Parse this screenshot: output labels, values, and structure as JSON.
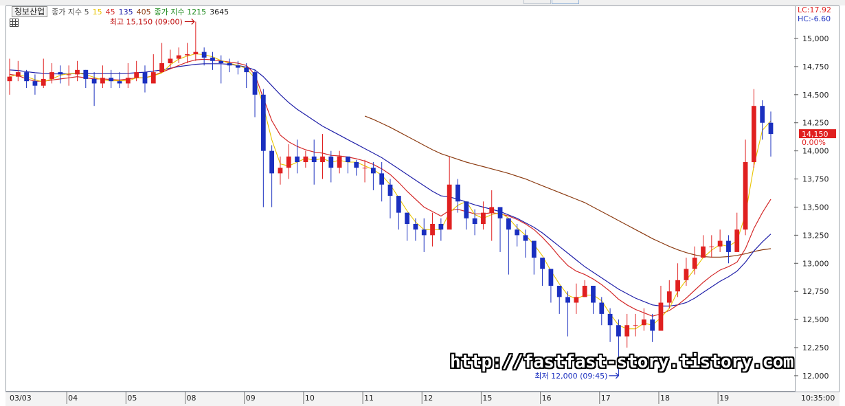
{
  "legend": {
    "stock_name": "청보산업",
    "ma_label": "종가 지수 5",
    "ma_periods": [
      "15",
      "45",
      "135",
      "405"
    ],
    "ma2_label": "종가 지수 1215",
    "ma2_period": "3645"
  },
  "right_header": {
    "lc": "LC:17.92",
    "hc": "HC:-6.60"
  },
  "watermark": "http://fastfast-story.tistory.com",
  "footer_time": "10:35:00",
  "colors": {
    "up": "#e02020",
    "down": "#1a2fbf",
    "ma5": "#e8c400",
    "ma15": "#d42a2a",
    "ma45": "#1f1fa8",
    "ma135": "#8b3a10",
    "ma1215": "#1d8a1d",
    "ma3645": "#222222",
    "grid": "#d8d8d8"
  },
  "chart_data": {
    "type": "candlestick",
    "ylim": [
      11920,
      15220
    ],
    "y_ticks": [
      12000,
      12250,
      12500,
      12750,
      13000,
      13250,
      13500,
      13750,
      14000,
      14250,
      14500,
      14750,
      15000
    ],
    "y_tick_labels": [
      "12,000",
      "12,250",
      "12,500",
      "12,750",
      "13,000",
      "13,250",
      "13,500",
      "13,750",
      "14,000",
      "14,250",
      "14,500",
      "14,750",
      "15,000"
    ],
    "x_day_labels": [
      "03/03",
      "04",
      "05",
      "08",
      "09",
      "10",
      "11",
      "12",
      "15",
      "16",
      "17",
      "18",
      "19"
    ],
    "current_price": 14150,
    "current_price_label": "14,150",
    "change_label": "0.00%",
    "high": {
      "value": 15150,
      "label": "최고 15,150 (09:00)"
    },
    "low": {
      "value": 12000,
      "label": "최저 12,000 (09:45)"
    },
    "closes": [
      14660,
      14700,
      14620,
      14580,
      14640,
      14700,
      14680,
      14680,
      14720,
      14640,
      14600,
      14650,
      14620,
      14600,
      14650,
      14700,
      14600,
      14700,
      14780,
      14820,
      14850,
      14860,
      14880,
      14830,
      14800,
      14780,
      14760,
      14740,
      14700,
      14500,
      14000,
      13800,
      13850,
      13950,
      13900,
      13950,
      13900,
      13950,
      13850,
      13950,
      13900,
      13850,
      13850,
      13800,
      13700,
      13600,
      13450,
      13350,
      13300,
      13250,
      13350,
      13300,
      13700,
      13550,
      13400,
      13350,
      13450,
      13500,
      13400,
      13300,
      13250,
      13200,
      13050,
      12950,
      12800,
      12700,
      12650,
      12700,
      12800,
      12650,
      12550,
      12450,
      12350,
      12450,
      12450,
      12500,
      12400,
      12650,
      12750,
      12850,
      12950,
      13050,
      13150,
      13150,
      13200,
      13100,
      13300,
      13900,
      14400,
      14250,
      14150
    ],
    "ranges": [
      [
        14500,
        14820
      ],
      [
        14620,
        14800
      ],
      [
        14560,
        14720
      ],
      [
        14500,
        14680
      ],
      [
        14560,
        14820
      ],
      [
        14600,
        14780
      ],
      [
        14600,
        14760
      ],
      [
        14580,
        14760
      ],
      [
        14620,
        14800
      ],
      [
        14560,
        14720
      ],
      [
        14400,
        14700
      ],
      [
        14560,
        14760
      ],
      [
        14560,
        14720
      ],
      [
        14560,
        14700
      ],
      [
        14560,
        14780
      ],
      [
        14620,
        14800
      ],
      [
        14520,
        14760
      ],
      [
        14620,
        14860
      ],
      [
        14700,
        14960
      ],
      [
        14740,
        14900
      ],
      [
        14780,
        14920
      ],
      [
        14780,
        14960
      ],
      [
        14800,
        15150
      ],
      [
        14760,
        14920
      ],
      [
        14720,
        14880
      ],
      [
        14600,
        14850
      ],
      [
        14700,
        14820
      ],
      [
        14680,
        14800
      ],
      [
        14560,
        14780
      ],
      [
        14300,
        14720
      ],
      [
        13500,
        14550
      ],
      [
        13500,
        14050
      ],
      [
        13700,
        13950
      ],
      [
        13750,
        14060
      ],
      [
        13800,
        14100
      ],
      [
        13850,
        14000
      ],
      [
        13700,
        14100
      ],
      [
        13750,
        14150
      ],
      [
        13720,
        14000
      ],
      [
        13800,
        14000
      ],
      [
        13800,
        13950
      ],
      [
        13780,
        13920
      ],
      [
        13720,
        13920
      ],
      [
        13650,
        13900
      ],
      [
        13550,
        13900
      ],
      [
        13400,
        13750
      ],
      [
        13300,
        13600
      ],
      [
        13200,
        13450
      ],
      [
        13200,
        13400
      ],
      [
        13100,
        13400
      ],
      [
        13150,
        13450
      ],
      [
        13200,
        13400
      ],
      [
        13500,
        13950
      ],
      [
        13450,
        13750
      ],
      [
        13300,
        13550
      ],
      [
        13250,
        13480
      ],
      [
        13300,
        13550
      ],
      [
        13200,
        13650
      ],
      [
        13100,
        13500
      ],
      [
        12900,
        13400
      ],
      [
        13150,
        13350
      ],
      [
        13050,
        13300
      ],
      [
        12900,
        13150
      ],
      [
        12800,
        13050
      ],
      [
        12650,
        12950
      ],
      [
        12550,
        12800
      ],
      [
        12350,
        12750
      ],
      [
        12550,
        12820
      ],
      [
        12700,
        12850
      ],
      [
        12550,
        12750
      ],
      [
        12450,
        12700
      ],
      [
        12300,
        12600
      ],
      [
        12000,
        12500
      ],
      [
        12250,
        12550
      ],
      [
        12350,
        12550
      ],
      [
        12400,
        12600
      ],
      [
        12300,
        12550
      ],
      [
        12450,
        12800
      ],
      [
        12600,
        12850
      ],
      [
        12700,
        13000
      ],
      [
        12800,
        13050
      ],
      [
        12900,
        13150
      ],
      [
        13050,
        13250
      ],
      [
        13050,
        13250
      ],
      [
        13100,
        13300
      ],
      [
        13000,
        13250
      ],
      [
        13150,
        13450
      ],
      [
        13250,
        14100
      ],
      [
        13850,
        14550
      ],
      [
        14100,
        14450
      ],
      [
        13950,
        14350
      ]
    ],
    "ma15_values": [
      14680,
      14670,
      14640,
      14620,
      14620,
      14630,
      14640,
      14650,
      14660,
      14650,
      14640,
      14640,
      14635,
      14630,
      14640,
      14650,
      14650,
      14670,
      14700,
      14730,
      14760,
      14790,
      14810,
      14815,
      14810,
      14800,
      14790,
      14780,
      14760,
      14680,
      14470,
      14270,
      14140,
      14080,
      14040,
      14010,
      13990,
      13980,
      13960,
      13955,
      13945,
      13930,
      13910,
      13880,
      13840,
      13790,
      13720,
      13640,
      13570,
      13500,
      13460,
      13420,
      13470,
      13480,
      13460,
      13440,
      13440,
      13450,
      13440,
      13420,
      13390,
      13350,
      13300,
      13230,
      13150,
      13060,
      12980,
      12930,
      12900,
      12860,
      12810,
      12750,
      12680,
      12630,
      12590,
      12560,
      12530,
      12550,
      12580,
      12630,
      12690,
      12760,
      12830,
      12890,
      12940,
      12970,
      13010,
      13130,
      13310,
      13450,
      13570
    ],
    "ma45_values": [
      14720,
      14715,
      14705,
      14695,
      14690,
      14685,
      14685,
      14685,
      14690,
      14690,
      14690,
      14690,
      14690,
      14690,
      14690,
      14695,
      14700,
      14710,
      14720,
      14735,
      14750,
      14760,
      14770,
      14775,
      14775,
      14775,
      14770,
      14760,
      14745,
      14720,
      14660,
      14580,
      14500,
      14430,
      14370,
      14320,
      14270,
      14220,
      14180,
      14140,
      14100,
      14060,
      14020,
      13980,
      13940,
      13890,
      13840,
      13790,
      13740,
      13690,
      13640,
      13600,
      13590,
      13570,
      13545,
      13520,
      13500,
      13480,
      13460,
      13430,
      13400,
      13360,
      13320,
      13270,
      13210,
      13150,
      13090,
      13030,
      12970,
      12920,
      12870,
      12820,
      12770,
      12730,
      12690,
      12660,
      12630,
      12620,
      12620,
      12630,
      12650,
      12690,
      12740,
      12790,
      12840,
      12880,
      12930,
      13010,
      13110,
      13190,
      13260
    ],
    "ma135_values": [
      null,
      null,
      null,
      null,
      null,
      null,
      null,
      null,
      null,
      null,
      null,
      null,
      null,
      null,
      null,
      null,
      null,
      null,
      null,
      null,
      null,
      null,
      null,
      null,
      null,
      null,
      null,
      null,
      null,
      null,
      null,
      null,
      null,
      null,
      null,
      null,
      null,
      null,
      null,
      null,
      null,
      null,
      14310,
      14280,
      14245,
      14210,
      14170,
      14130,
      14090,
      14050,
      14010,
      13975,
      13950,
      13925,
      13900,
      13880,
      13860,
      13840,
      13820,
      13800,
      13775,
      13750,
      13720,
      13690,
      13660,
      13630,
      13600,
      13570,
      13540,
      13500,
      13460,
      13420,
      13380,
      13340,
      13300,
      13260,
      13220,
      13185,
      13150,
      13120,
      13095,
      13075,
      13060,
      13055,
      13055,
      13060,
      13070,
      13085,
      13105,
      13120,
      13130
    ]
  }
}
